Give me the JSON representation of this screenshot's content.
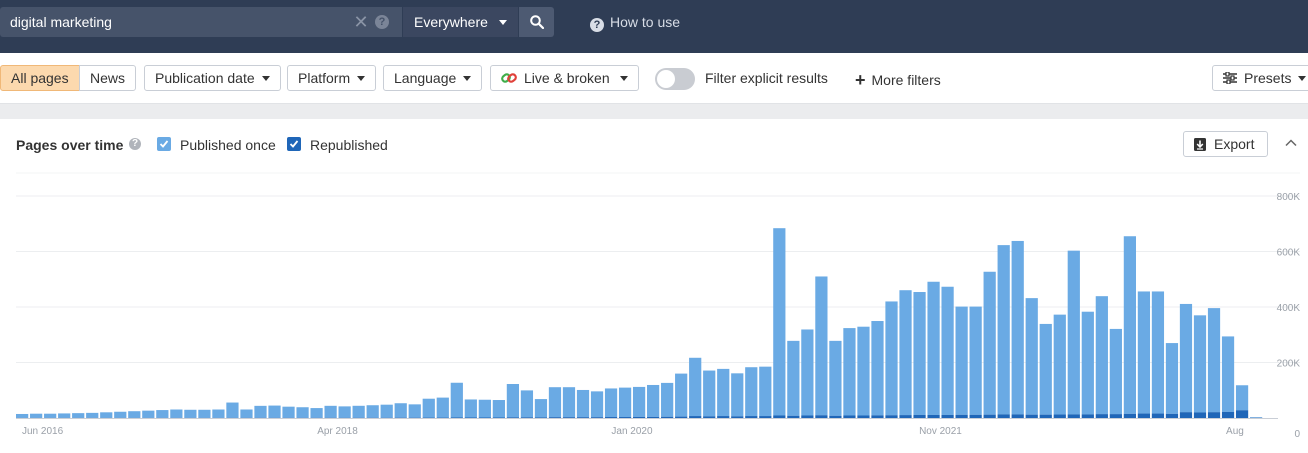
{
  "search": {
    "value": "digital marketing",
    "clear_icon": "close-icon",
    "help_icon": "question-icon",
    "scope_label": "Everywhere",
    "button_icon": "search-icon"
  },
  "header": {
    "how_to_use": "How to use"
  },
  "filters": {
    "all_pages": "All pages",
    "news": "News",
    "publication_date": "Publication date",
    "platform": "Platform",
    "language": "Language",
    "live_broken": "Live & broken",
    "explicit_label": "Filter explicit results",
    "explicit_enabled": false,
    "more_filters": "More filters",
    "presets": "Presets"
  },
  "panel": {
    "title": "Pages over time",
    "legend_published_once": "Published once",
    "legend_republished": "Republished",
    "export": "Export"
  },
  "colors": {
    "published_once": "#6aaae4",
    "republished": "#1f66b8",
    "topbar": "#2f3d55",
    "accent_orange": "#fcd9ae"
  },
  "chart_data": {
    "type": "bar",
    "stacked": true,
    "ylim": [
      0,
      800000
    ],
    "y_ticks": [
      "800K",
      "600K",
      "400K",
      "200K",
      "0"
    ],
    "x_labels": [
      "Jun 2016",
      "Apr 2018",
      "Jan 2020",
      "Nov 2021",
      "Aug"
    ],
    "categories_start": "Jun 2016",
    "categories_end": "Aug 2023",
    "grid": true,
    "series": [
      {
        "name": "Published once",
        "color": "#6aaae4",
        "values": [
          14000,
          15000,
          15000,
          16000,
          17000,
          18000,
          20000,
          22000,
          24000,
          26000,
          28000,
          30000,
          29000,
          29000,
          30000,
          55000,
          30000,
          43000,
          44000,
          40000,
          38000,
          35000,
          43000,
          41000,
          43000,
          45000,
          47000,
          52000,
          48000,
          68000,
          72000,
          125000,
          65000,
          64000,
          63000,
          120000,
          97000,
          66000,
          108000,
          108000,
          98000,
          93000,
          103000,
          106000,
          108000,
          115000,
          122000,
          155000,
          210000,
          165000,
          170000,
          155000,
          176000,
          178000,
          675000,
          270000,
          310000,
          500000,
          270000,
          315000,
          320000,
          340000,
          410000,
          450000,
          443000,
          480000,
          462000,
          390000,
          390000,
          515000,
          610000,
          625000,
          420000,
          327000,
          360000,
          590000,
          370000,
          425000,
          307000,
          640000,
          440000,
          440000,
          255000,
          390000,
          350000,
          375000,
          272000,
          90000,
          2000
        ]
      },
      {
        "name": "Republished",
        "color": "#1f66b8",
        "values": [
          500,
          500,
          500,
          500,
          500,
          500,
          500,
          500,
          500,
          500,
          600,
          600,
          600,
          600,
          600,
          700,
          700,
          800,
          800,
          800,
          800,
          800,
          900,
          900,
          1000,
          1000,
          1000,
          1200,
          1200,
          1500,
          1500,
          2000,
          1800,
          1800,
          1800,
          2500,
          2500,
          2200,
          3000,
          3000,
          3000,
          3000,
          3500,
          3500,
          4000,
          4000,
          4500,
          5000,
          7000,
          6000,
          7000,
          6000,
          7000,
          7000,
          9000,
          8000,
          9000,
          10000,
          8000,
          9000,
          9000,
          9500,
          10000,
          10500,
          11000,
          11000,
          11000,
          11500,
          11500,
          12000,
          13000,
          13000,
          12000,
          12000,
          12500,
          13000,
          13000,
          14000,
          14000,
          15000,
          16000,
          16000,
          15000,
          21000,
          20000,
          21000,
          22000,
          28000,
          1000
        ]
      }
    ]
  }
}
